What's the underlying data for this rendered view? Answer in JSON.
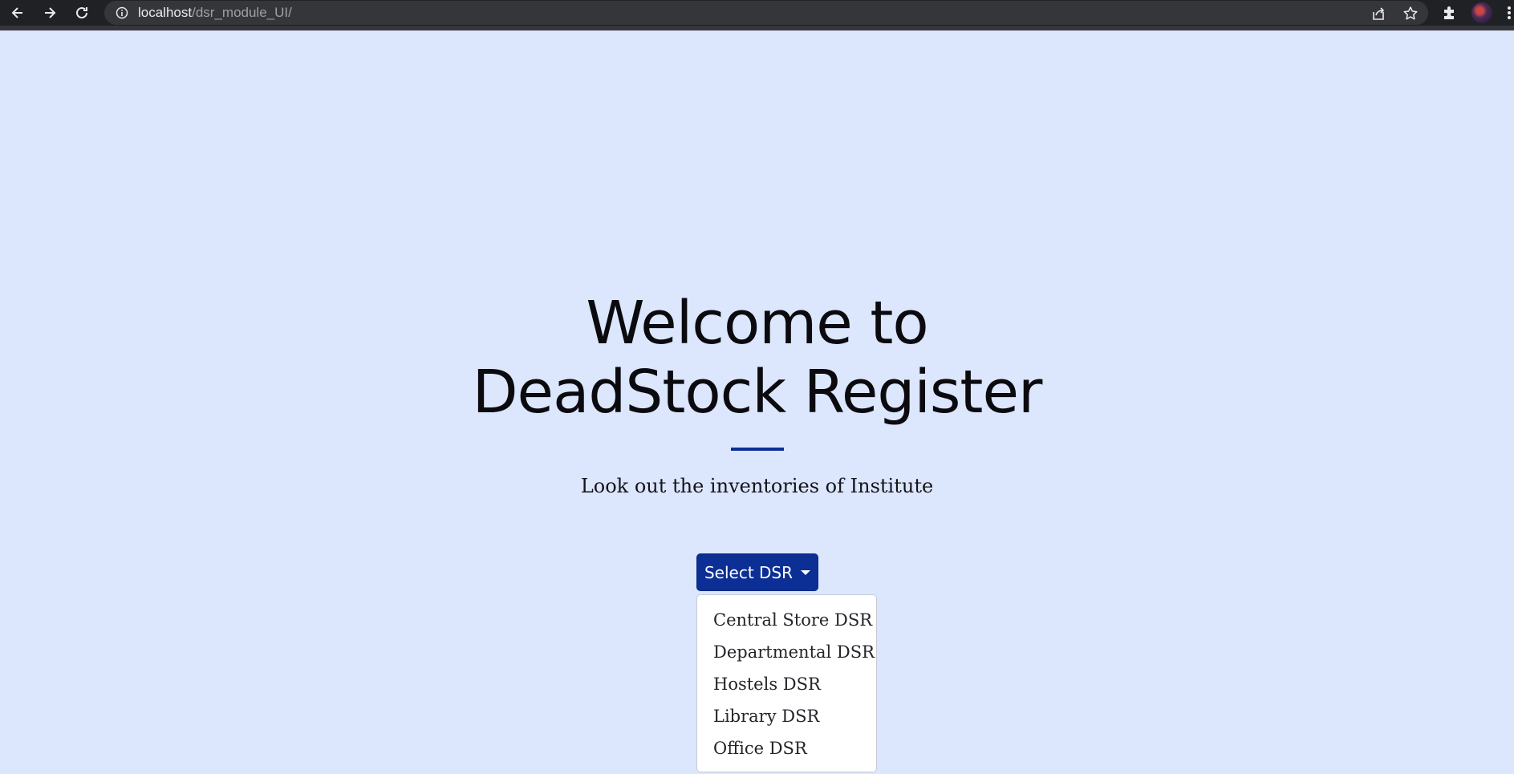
{
  "browser": {
    "url_host": "localhost",
    "url_path": "/dsr_module_UI/",
    "icons": {
      "back": "back-arrow-icon",
      "forward": "forward-arrow-icon",
      "reload": "reload-icon",
      "info": "info-icon",
      "share": "share-icon",
      "bookmark": "star-icon",
      "extensions": "puzzle-icon",
      "profile": "avatar",
      "menu": "menu-dots-icon"
    }
  },
  "hero": {
    "title": "Welcome to DeadStock Register",
    "subtitle": "Look out the inventories of Institute"
  },
  "dsr_select": {
    "button_label": "Select DSR",
    "items": [
      {
        "label": "Central Store DSR"
      },
      {
        "label": "Departmental DSR"
      },
      {
        "label": "Hostels DSR"
      },
      {
        "label": "Library DSR"
      },
      {
        "label": "Office DSR"
      }
    ]
  },
  "colors": {
    "page_background": "#dce6fd",
    "accent": "#0b2f94",
    "browser_chrome": "#202124"
  }
}
